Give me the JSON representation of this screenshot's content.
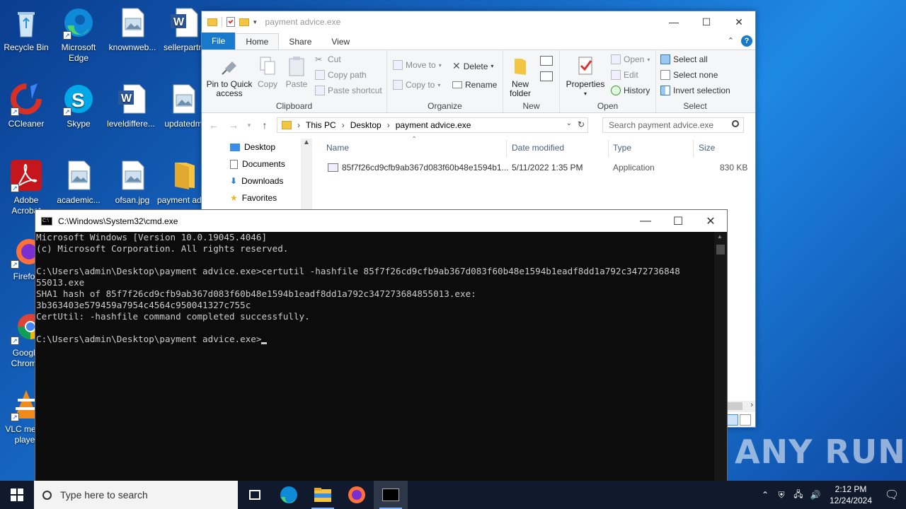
{
  "desktop": {
    "icons": [
      {
        "label": "Recycle Bin"
      },
      {
        "label": "Microsoft Edge"
      },
      {
        "label": "knownweb..."
      },
      {
        "label": "sellerpartn"
      },
      {
        "label": "CCleaner"
      },
      {
        "label": "Skype"
      },
      {
        "label": "leveldiffere..."
      },
      {
        "label": "updatedm"
      },
      {
        "label": "Adobe Acrobat"
      },
      {
        "label": "academic..."
      },
      {
        "label": "ofsan.jpg"
      },
      {
        "label": "payment advice.exe"
      },
      {
        "label": "Firefox"
      },
      {
        "label": "Google Chrome"
      },
      {
        "label": "VLC media player"
      }
    ]
  },
  "explorer": {
    "title": "payment advice.exe",
    "tabs": {
      "file": "File",
      "home": "Home",
      "share": "Share",
      "view": "View"
    },
    "clipboard": {
      "group": "Clipboard",
      "pin": "Pin to Quick access",
      "copy": "Copy",
      "paste": "Paste",
      "cut": "Cut",
      "copy_path": "Copy path",
      "paste_shortcut": "Paste shortcut"
    },
    "organize": {
      "group": "Organize",
      "move_to": "Move to",
      "copy_to": "Copy to",
      "delete": "Delete",
      "rename": "Rename"
    },
    "new": {
      "group": "New",
      "new_folder": "New folder"
    },
    "open": {
      "group": "Open",
      "properties": "Properties",
      "open": "Open",
      "edit": "Edit",
      "history": "History"
    },
    "select": {
      "group": "Select",
      "select_all": "Select all",
      "select_none": "Select none",
      "invert": "Invert selection"
    },
    "address": {
      "crumbs": [
        "This PC",
        "Desktop",
        "payment advice.exe"
      ]
    },
    "search_placeholder": "Search payment advice.exe",
    "nav": [
      "Desktop",
      "Documents",
      "Downloads",
      "Favorites"
    ],
    "columns": {
      "name": "Name",
      "date": "Date modified",
      "type": "Type",
      "size": "Size"
    },
    "files": [
      {
        "name": "85f7f26cd9cfb9ab367d083f60b48e1594b1...",
        "date": "5/11/2022 1:35 PM",
        "type": "Application",
        "size": "830 KB"
      }
    ]
  },
  "cmd": {
    "title": "C:\\Windows\\System32\\cmd.exe",
    "lines": [
      "Microsoft Windows [Version 10.0.19045.4046]",
      "(c) Microsoft Corporation. All rights reserved.",
      "",
      "C:\\Users\\admin\\Desktop\\payment advice.exe>certutil -hashfile 85f7f26cd9cfb9ab367d083f60b48e1594b1eadf8dd1a792c3472736848",
      "55013.exe",
      "SHA1 hash of 85f7f26cd9cfb9ab367d083f60b48e1594b1eadf8dd1a792c347273684855013.exe:",
      "3b363403e579459a7954c4564c950041327c755c",
      "CertUtil: -hashfile command completed successfully.",
      "",
      "C:\\Users\\admin\\Desktop\\payment advice.exe>"
    ]
  },
  "taskbar": {
    "search_placeholder": "Type here to search",
    "time": "2:12 PM",
    "date": "12/24/2024"
  },
  "watermark": "ANY RUN"
}
